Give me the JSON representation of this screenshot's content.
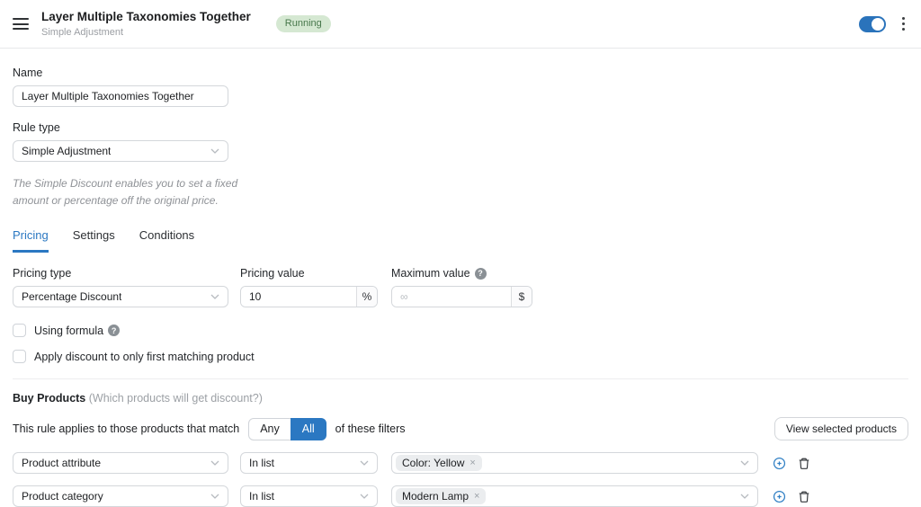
{
  "colors": {
    "accent_blue": "#2b78c2",
    "badge_bg": "#d5e8d2",
    "badge_text": "#47774b"
  },
  "glyphs": {
    "close": "×",
    "question": "?"
  },
  "header": {
    "title": "Layer Multiple Taxonomies Together",
    "subtitle": "Simple Adjustment",
    "status_badge": "Running"
  },
  "form": {
    "name_label": "Name",
    "name_value": "Layer Multiple Taxonomies Together",
    "rule_type_label": "Rule type",
    "rule_type_value": "Simple Adjustment",
    "rule_type_help": "The Simple Discount enables you to set a fixed amount or percentage off the original price."
  },
  "tabs": [
    {
      "label": "Pricing",
      "active": true
    },
    {
      "label": "Settings",
      "active": false
    },
    {
      "label": "Conditions",
      "active": false
    }
  ],
  "pricing": {
    "pricing_type_label": "Pricing type",
    "pricing_type_value": "Percentage Discount",
    "pricing_value_label": "Pricing value",
    "pricing_value": "10",
    "pricing_value_unit": "%",
    "maximum_value_label": "Maximum value",
    "maximum_value_placeholder": "∞",
    "maximum_value_unit": "$",
    "using_formula_label": "Using formula",
    "first_match_label": "Apply discount to only first matching product"
  },
  "buy_products": {
    "title": "Buy Products",
    "subtitle": "(Which products will get discount?)",
    "match_text_before": "This rule applies to those products that match",
    "match_options": [
      "Any",
      "All"
    ],
    "match_selected": "All",
    "match_text_after": "of these filters",
    "view_selected_button": "View selected products",
    "filters": [
      {
        "field": "Product attribute",
        "operator": "In list",
        "values": [
          "Color: Yellow"
        ]
      },
      {
        "field": "Product category",
        "operator": "In list",
        "values": [
          "Modern Lamp"
        ]
      }
    ]
  }
}
